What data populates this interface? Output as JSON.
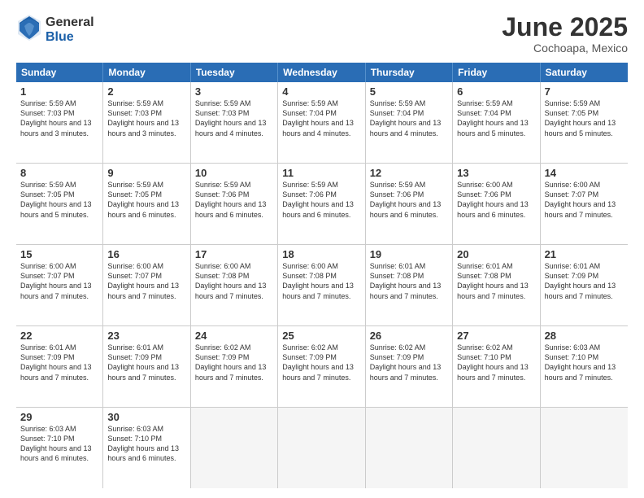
{
  "header": {
    "logo_line1": "General",
    "logo_line2": "Blue",
    "month": "June 2025",
    "location": "Cochoapa, Mexico"
  },
  "days_of_week": [
    "Sunday",
    "Monday",
    "Tuesday",
    "Wednesday",
    "Thursday",
    "Friday",
    "Saturday"
  ],
  "weeks": [
    [
      {
        "day": "1",
        "sr": "5:59 AM",
        "ss": "7:03 PM",
        "dl": "13 hours and 3 minutes."
      },
      {
        "day": "2",
        "sr": "5:59 AM",
        "ss": "7:03 PM",
        "dl": "13 hours and 3 minutes."
      },
      {
        "day": "3",
        "sr": "5:59 AM",
        "ss": "7:03 PM",
        "dl": "13 hours and 4 minutes."
      },
      {
        "day": "4",
        "sr": "5:59 AM",
        "ss": "7:04 PM",
        "dl": "13 hours and 4 minutes."
      },
      {
        "day": "5",
        "sr": "5:59 AM",
        "ss": "7:04 PM",
        "dl": "13 hours and 4 minutes."
      },
      {
        "day": "6",
        "sr": "5:59 AM",
        "ss": "7:04 PM",
        "dl": "13 hours and 5 minutes."
      },
      {
        "day": "7",
        "sr": "5:59 AM",
        "ss": "7:05 PM",
        "dl": "13 hours and 5 minutes."
      }
    ],
    [
      {
        "day": "8",
        "sr": "5:59 AM",
        "ss": "7:05 PM",
        "dl": "13 hours and 5 minutes."
      },
      {
        "day": "9",
        "sr": "5:59 AM",
        "ss": "7:05 PM",
        "dl": "13 hours and 6 minutes."
      },
      {
        "day": "10",
        "sr": "5:59 AM",
        "ss": "7:06 PM",
        "dl": "13 hours and 6 minutes."
      },
      {
        "day": "11",
        "sr": "5:59 AM",
        "ss": "7:06 PM",
        "dl": "13 hours and 6 minutes."
      },
      {
        "day": "12",
        "sr": "5:59 AM",
        "ss": "7:06 PM",
        "dl": "13 hours and 6 minutes."
      },
      {
        "day": "13",
        "sr": "6:00 AM",
        "ss": "7:06 PM",
        "dl": "13 hours and 6 minutes."
      },
      {
        "day": "14",
        "sr": "6:00 AM",
        "ss": "7:07 PM",
        "dl": "13 hours and 7 minutes."
      }
    ],
    [
      {
        "day": "15",
        "sr": "6:00 AM",
        "ss": "7:07 PM",
        "dl": "13 hours and 7 minutes."
      },
      {
        "day": "16",
        "sr": "6:00 AM",
        "ss": "7:07 PM",
        "dl": "13 hours and 7 minutes."
      },
      {
        "day": "17",
        "sr": "6:00 AM",
        "ss": "7:08 PM",
        "dl": "13 hours and 7 minutes."
      },
      {
        "day": "18",
        "sr": "6:00 AM",
        "ss": "7:08 PM",
        "dl": "13 hours and 7 minutes."
      },
      {
        "day": "19",
        "sr": "6:01 AM",
        "ss": "7:08 PM",
        "dl": "13 hours and 7 minutes."
      },
      {
        "day": "20",
        "sr": "6:01 AM",
        "ss": "7:08 PM",
        "dl": "13 hours and 7 minutes."
      },
      {
        "day": "21",
        "sr": "6:01 AM",
        "ss": "7:09 PM",
        "dl": "13 hours and 7 minutes."
      }
    ],
    [
      {
        "day": "22",
        "sr": "6:01 AM",
        "ss": "7:09 PM",
        "dl": "13 hours and 7 minutes."
      },
      {
        "day": "23",
        "sr": "6:01 AM",
        "ss": "7:09 PM",
        "dl": "13 hours and 7 minutes."
      },
      {
        "day": "24",
        "sr": "6:02 AM",
        "ss": "7:09 PM",
        "dl": "13 hours and 7 minutes."
      },
      {
        "day": "25",
        "sr": "6:02 AM",
        "ss": "7:09 PM",
        "dl": "13 hours and 7 minutes."
      },
      {
        "day": "26",
        "sr": "6:02 AM",
        "ss": "7:09 PM",
        "dl": "13 hours and 7 minutes."
      },
      {
        "day": "27",
        "sr": "6:02 AM",
        "ss": "7:10 PM",
        "dl": "13 hours and 7 minutes."
      },
      {
        "day": "28",
        "sr": "6:03 AM",
        "ss": "7:10 PM",
        "dl": "13 hours and 7 minutes."
      }
    ],
    [
      {
        "day": "29",
        "sr": "6:03 AM",
        "ss": "7:10 PM",
        "dl": "13 hours and 6 minutes."
      },
      {
        "day": "30",
        "sr": "6:03 AM",
        "ss": "7:10 PM",
        "dl": "13 hours and 6 minutes."
      },
      null,
      null,
      null,
      null,
      null
    ]
  ],
  "labels": {
    "sunrise": "Sunrise: ",
    "sunset": "Sunset: ",
    "daylight": "Daylight: "
  }
}
